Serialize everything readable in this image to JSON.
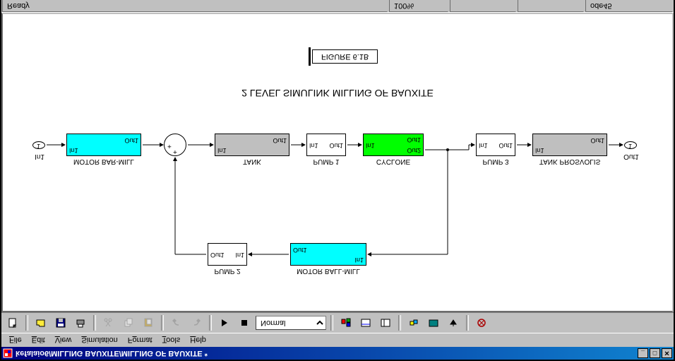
{
  "window": {
    "title": "kefalaio6/MILLING BAUXITE/MILLING OF BAUXITE *",
    "min_glyph": "_",
    "max_glyph": "□",
    "close_glyph": "✕"
  },
  "menu": {
    "file": "File",
    "edit": "Edit",
    "view": "View",
    "simulation": "Simulation",
    "format": "Format",
    "tools": "Tools",
    "help": "Help"
  },
  "toolbar": {
    "mode": "Normal"
  },
  "status": {
    "ready": "Ready",
    "zoom": "100%",
    "empty1": "",
    "empty2": "",
    "solver": "ode45"
  },
  "diagram": {
    "title": "2 LEVEL SIMULINK MILLING OF BAUXITE",
    "figure_label": "FIGURE 6.1B",
    "in_port": "In1",
    "out_port": "Out1",
    "in1": "In1",
    "out1": "Out1",
    "out2": "Out2",
    "blocks": {
      "barmill": "MOTOR BAR-MILL",
      "tank": "TANK",
      "pump1": "PUMP 1",
      "cyclone": "CYCLONE",
      "pump3": "PUMP 3",
      "tankpros": "TANK PROSVOLIS",
      "pump2": "PUMP 2",
      "ballmill": "MOTOR BALL-MILL"
    }
  }
}
